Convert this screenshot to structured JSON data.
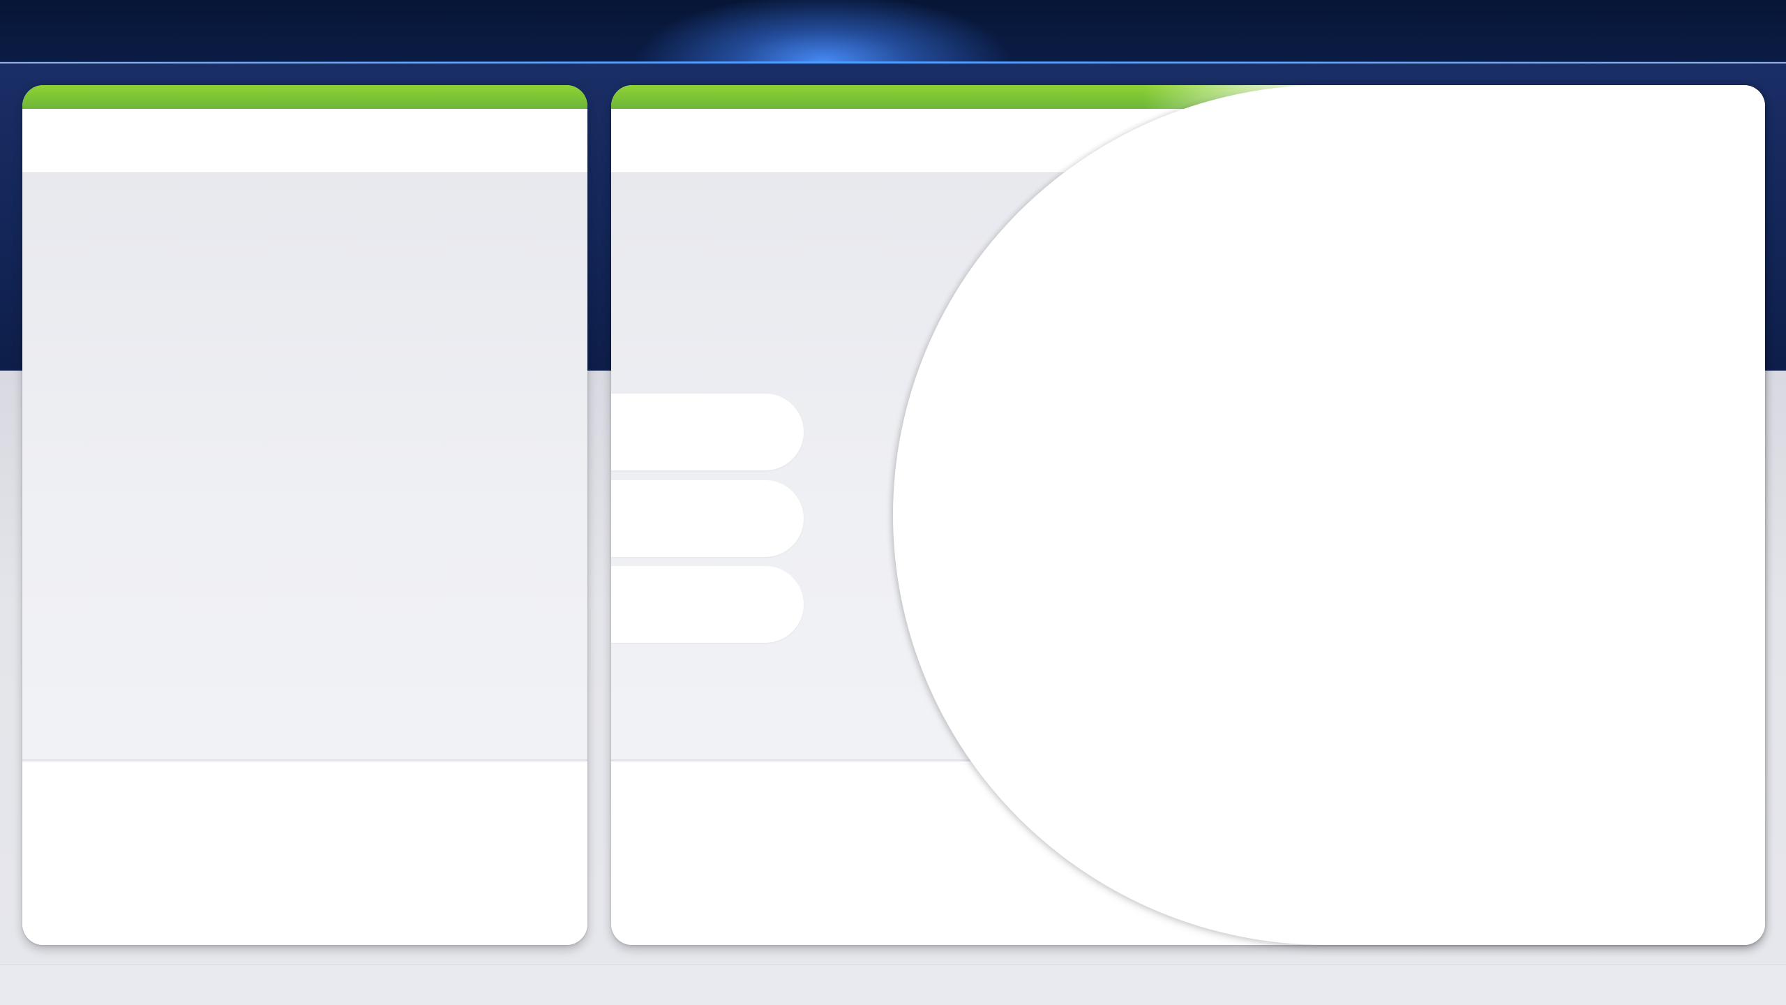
{
  "colors": {
    "nav_bg": "#071636",
    "nav_glow": "#4f9cff",
    "hero_bg": "#1a2e66",
    "accent_green": "#8ed332",
    "card_bg": "#ffffff",
    "card_body_bg": "#eff0f4",
    "page_bg": "#e6e7ec"
  },
  "top_nav": {},
  "cards": [
    {
      "id": "left-card"
    },
    {
      "id": "right-card",
      "buttons": [
        {},
        {},
        {}
      ]
    }
  ],
  "overlay": {}
}
